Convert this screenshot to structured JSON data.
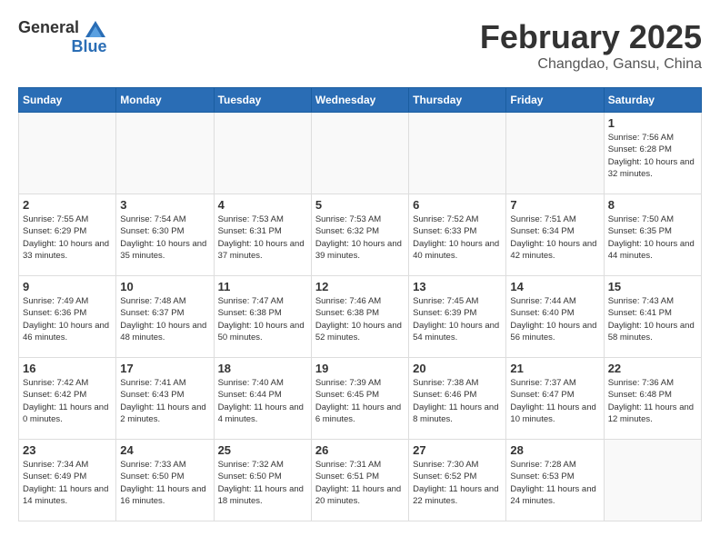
{
  "header": {
    "logo_general": "General",
    "logo_blue": "Blue",
    "month_year": "February 2025",
    "location": "Changdao, Gansu, China"
  },
  "days_of_week": [
    "Sunday",
    "Monday",
    "Tuesday",
    "Wednesday",
    "Thursday",
    "Friday",
    "Saturday"
  ],
  "weeks": [
    [
      {
        "day": "",
        "info": ""
      },
      {
        "day": "",
        "info": ""
      },
      {
        "day": "",
        "info": ""
      },
      {
        "day": "",
        "info": ""
      },
      {
        "day": "",
        "info": ""
      },
      {
        "day": "",
        "info": ""
      },
      {
        "day": "1",
        "info": "Sunrise: 7:56 AM\nSunset: 6:28 PM\nDaylight: 10 hours and 32 minutes."
      }
    ],
    [
      {
        "day": "2",
        "info": "Sunrise: 7:55 AM\nSunset: 6:29 PM\nDaylight: 10 hours and 33 minutes."
      },
      {
        "day": "3",
        "info": "Sunrise: 7:54 AM\nSunset: 6:30 PM\nDaylight: 10 hours and 35 minutes."
      },
      {
        "day": "4",
        "info": "Sunrise: 7:53 AM\nSunset: 6:31 PM\nDaylight: 10 hours and 37 minutes."
      },
      {
        "day": "5",
        "info": "Sunrise: 7:53 AM\nSunset: 6:32 PM\nDaylight: 10 hours and 39 minutes."
      },
      {
        "day": "6",
        "info": "Sunrise: 7:52 AM\nSunset: 6:33 PM\nDaylight: 10 hours and 40 minutes."
      },
      {
        "day": "7",
        "info": "Sunrise: 7:51 AM\nSunset: 6:34 PM\nDaylight: 10 hours and 42 minutes."
      },
      {
        "day": "8",
        "info": "Sunrise: 7:50 AM\nSunset: 6:35 PM\nDaylight: 10 hours and 44 minutes."
      }
    ],
    [
      {
        "day": "9",
        "info": "Sunrise: 7:49 AM\nSunset: 6:36 PM\nDaylight: 10 hours and 46 minutes."
      },
      {
        "day": "10",
        "info": "Sunrise: 7:48 AM\nSunset: 6:37 PM\nDaylight: 10 hours and 48 minutes."
      },
      {
        "day": "11",
        "info": "Sunrise: 7:47 AM\nSunset: 6:38 PM\nDaylight: 10 hours and 50 minutes."
      },
      {
        "day": "12",
        "info": "Sunrise: 7:46 AM\nSunset: 6:38 PM\nDaylight: 10 hours and 52 minutes."
      },
      {
        "day": "13",
        "info": "Sunrise: 7:45 AM\nSunset: 6:39 PM\nDaylight: 10 hours and 54 minutes."
      },
      {
        "day": "14",
        "info": "Sunrise: 7:44 AM\nSunset: 6:40 PM\nDaylight: 10 hours and 56 minutes."
      },
      {
        "day": "15",
        "info": "Sunrise: 7:43 AM\nSunset: 6:41 PM\nDaylight: 10 hours and 58 minutes."
      }
    ],
    [
      {
        "day": "16",
        "info": "Sunrise: 7:42 AM\nSunset: 6:42 PM\nDaylight: 11 hours and 0 minutes."
      },
      {
        "day": "17",
        "info": "Sunrise: 7:41 AM\nSunset: 6:43 PM\nDaylight: 11 hours and 2 minutes."
      },
      {
        "day": "18",
        "info": "Sunrise: 7:40 AM\nSunset: 6:44 PM\nDaylight: 11 hours and 4 minutes."
      },
      {
        "day": "19",
        "info": "Sunrise: 7:39 AM\nSunset: 6:45 PM\nDaylight: 11 hours and 6 minutes."
      },
      {
        "day": "20",
        "info": "Sunrise: 7:38 AM\nSunset: 6:46 PM\nDaylight: 11 hours and 8 minutes."
      },
      {
        "day": "21",
        "info": "Sunrise: 7:37 AM\nSunset: 6:47 PM\nDaylight: 11 hours and 10 minutes."
      },
      {
        "day": "22",
        "info": "Sunrise: 7:36 AM\nSunset: 6:48 PM\nDaylight: 11 hours and 12 minutes."
      }
    ],
    [
      {
        "day": "23",
        "info": "Sunrise: 7:34 AM\nSunset: 6:49 PM\nDaylight: 11 hours and 14 minutes."
      },
      {
        "day": "24",
        "info": "Sunrise: 7:33 AM\nSunset: 6:50 PM\nDaylight: 11 hours and 16 minutes."
      },
      {
        "day": "25",
        "info": "Sunrise: 7:32 AM\nSunset: 6:50 PM\nDaylight: 11 hours and 18 minutes."
      },
      {
        "day": "26",
        "info": "Sunrise: 7:31 AM\nSunset: 6:51 PM\nDaylight: 11 hours and 20 minutes."
      },
      {
        "day": "27",
        "info": "Sunrise: 7:30 AM\nSunset: 6:52 PM\nDaylight: 11 hours and 22 minutes."
      },
      {
        "day": "28",
        "info": "Sunrise: 7:28 AM\nSunset: 6:53 PM\nDaylight: 11 hours and 24 minutes."
      },
      {
        "day": "",
        "info": ""
      }
    ]
  ]
}
